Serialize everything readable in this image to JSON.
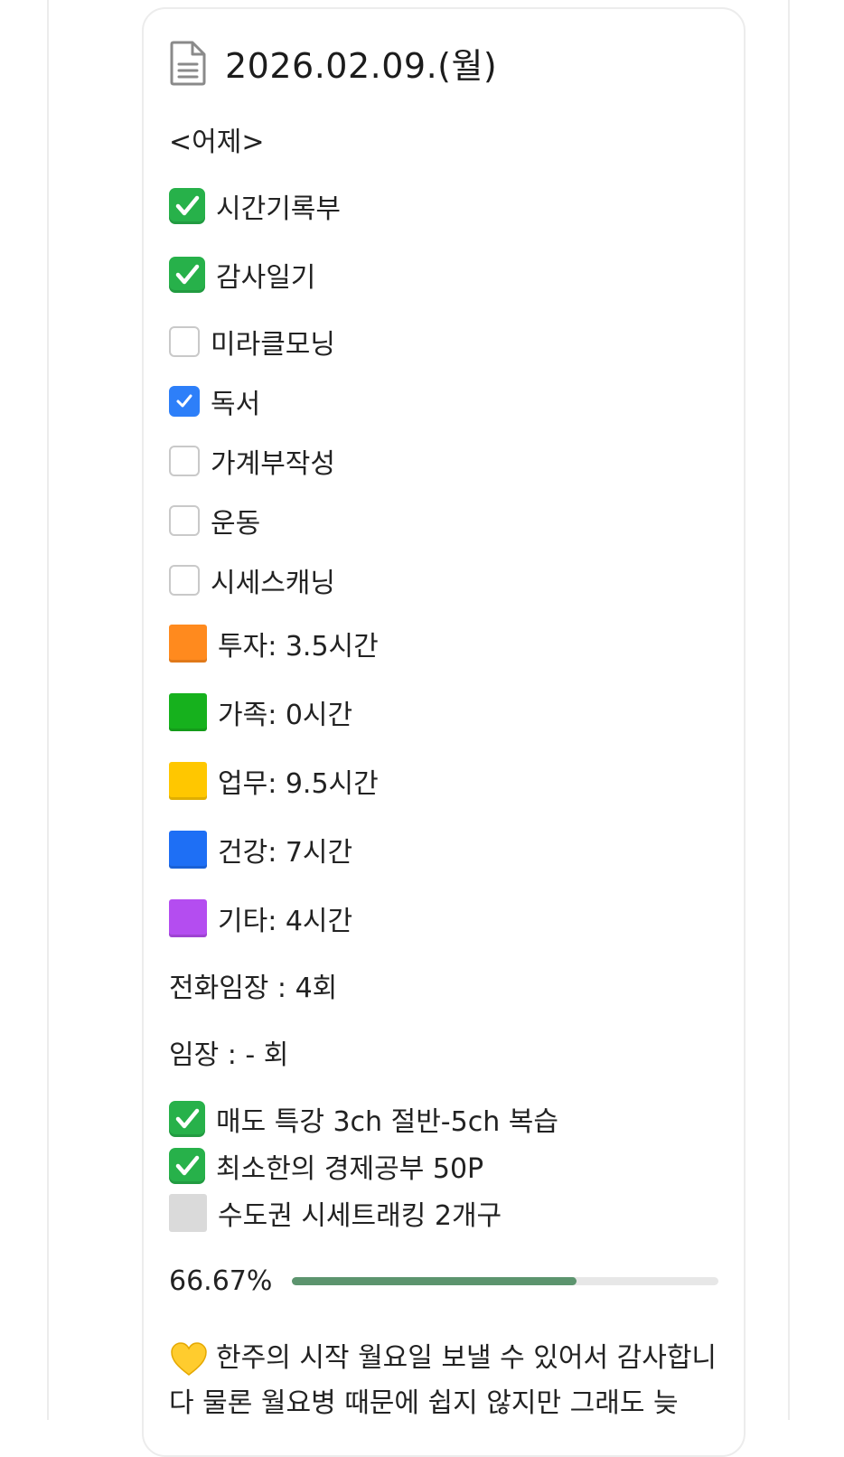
{
  "header": {
    "title": "2026.02.09.(월)",
    "icon": "document-icon"
  },
  "section_label": "<어제>",
  "habits": [
    {
      "label": "시간기록부",
      "state": "emoji-check"
    },
    {
      "label": "감사일기",
      "state": "emoji-check"
    },
    {
      "label": "미라클모닝",
      "state": "unchecked"
    },
    {
      "label": "독서",
      "state": "checked"
    },
    {
      "label": "가계부작성",
      "state": "unchecked"
    },
    {
      "label": "운동",
      "state": "unchecked"
    },
    {
      "label": "시세스캐닝",
      "state": "unchecked"
    }
  ],
  "time_log": [
    {
      "label": "투자: 3.5시간",
      "color": "#ff8a1e"
    },
    {
      "label": "가족: 0시간",
      "color": "#16b11d"
    },
    {
      "label": "업무: 9.5시간",
      "color": "#ffc700"
    },
    {
      "label": "건강: 7시간",
      "color": "#1e6ff5"
    },
    {
      "label": "기타: 4시간",
      "color": "#b44df0"
    }
  ],
  "counts": {
    "phone_visit": "전화임장 : 4회",
    "visit": "임장 : - 회"
  },
  "tasks": [
    {
      "label": "매도 특강 3ch 절반-5ch 복습",
      "state": "done"
    },
    {
      "label": "최소한의 경제공부 50P",
      "state": "done"
    },
    {
      "label": "수도권 시세트래킹 2개구",
      "state": "todo"
    }
  ],
  "progress": {
    "label": "66.67%",
    "value": 0.6667,
    "color": "#5c946e"
  },
  "gratitude": {
    "icon": "yellow-heart-icon",
    "text": "한주의 시작 월요일 보낼 수 있어서 감사합니다 물론 월요병 때문에 쉽지 않지만 그래도 늦"
  }
}
